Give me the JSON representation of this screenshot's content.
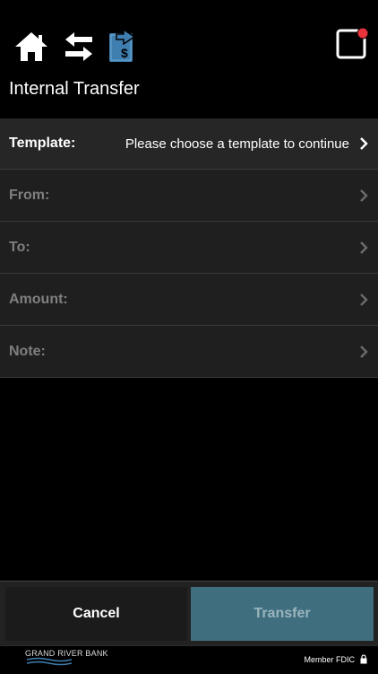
{
  "header": {
    "title": "Internal Transfer",
    "icons": [
      "home-icon",
      "transfer-arrows-icon",
      "money-transfer-icon",
      "notification-icon"
    ],
    "notification_dot_color": "#e8323c"
  },
  "form": {
    "template": {
      "label": "Template:",
      "value": "Please choose a template to continue"
    },
    "from": {
      "label": "From:",
      "value": ""
    },
    "to": {
      "label": "To:",
      "value": ""
    },
    "amount": {
      "label": "Amount:",
      "value": ""
    },
    "note": {
      "label": "Note:",
      "value": ""
    }
  },
  "actions": {
    "cancel_label": "Cancel",
    "transfer_label": "Transfer"
  },
  "footer": {
    "brand": "GRAND RIVER BANK",
    "member_text": "Member FDIC"
  },
  "colors": {
    "accent": "#3f7fb0",
    "transfer_button": "#3f6e7e"
  }
}
